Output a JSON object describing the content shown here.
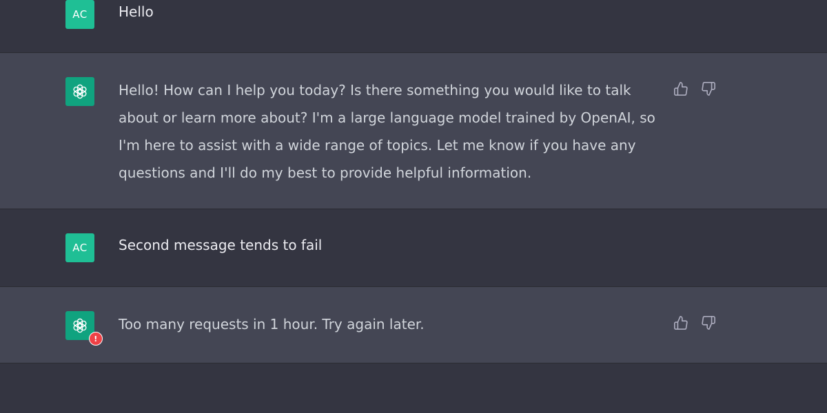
{
  "colors": {
    "page_bg": "#343541",
    "assistant_row_bg": "#444654",
    "user_avatar": "#1fbf95",
    "assistant_avatar": "#10a37f",
    "error_text": "#ef4146"
  },
  "conversation": [
    {
      "role": "user",
      "avatar_initials": "AC",
      "text": "Hello"
    },
    {
      "role": "assistant",
      "avatar_icon": "openai-logo-icon",
      "text": "Hello! How can I help you today? Is there something you would like to talk about or learn more about? I'm a large language model trained by OpenAI, so I'm here to assist with a wide range of topics. Let me know if you have any questions and I'll do my best to provide helpful information.",
      "feedback_icons": [
        "thumbs-up-icon",
        "thumbs-down-icon"
      ]
    },
    {
      "role": "user",
      "avatar_initials": "AC",
      "text": "Second message tends to fail"
    },
    {
      "role": "assistant",
      "avatar_icon": "openai-logo-icon",
      "error_badge": "!",
      "text": "Too many requests in 1 hour. Try again later.",
      "is_error": true,
      "feedback_icons": [
        "thumbs-up-icon",
        "thumbs-down-icon"
      ]
    }
  ]
}
